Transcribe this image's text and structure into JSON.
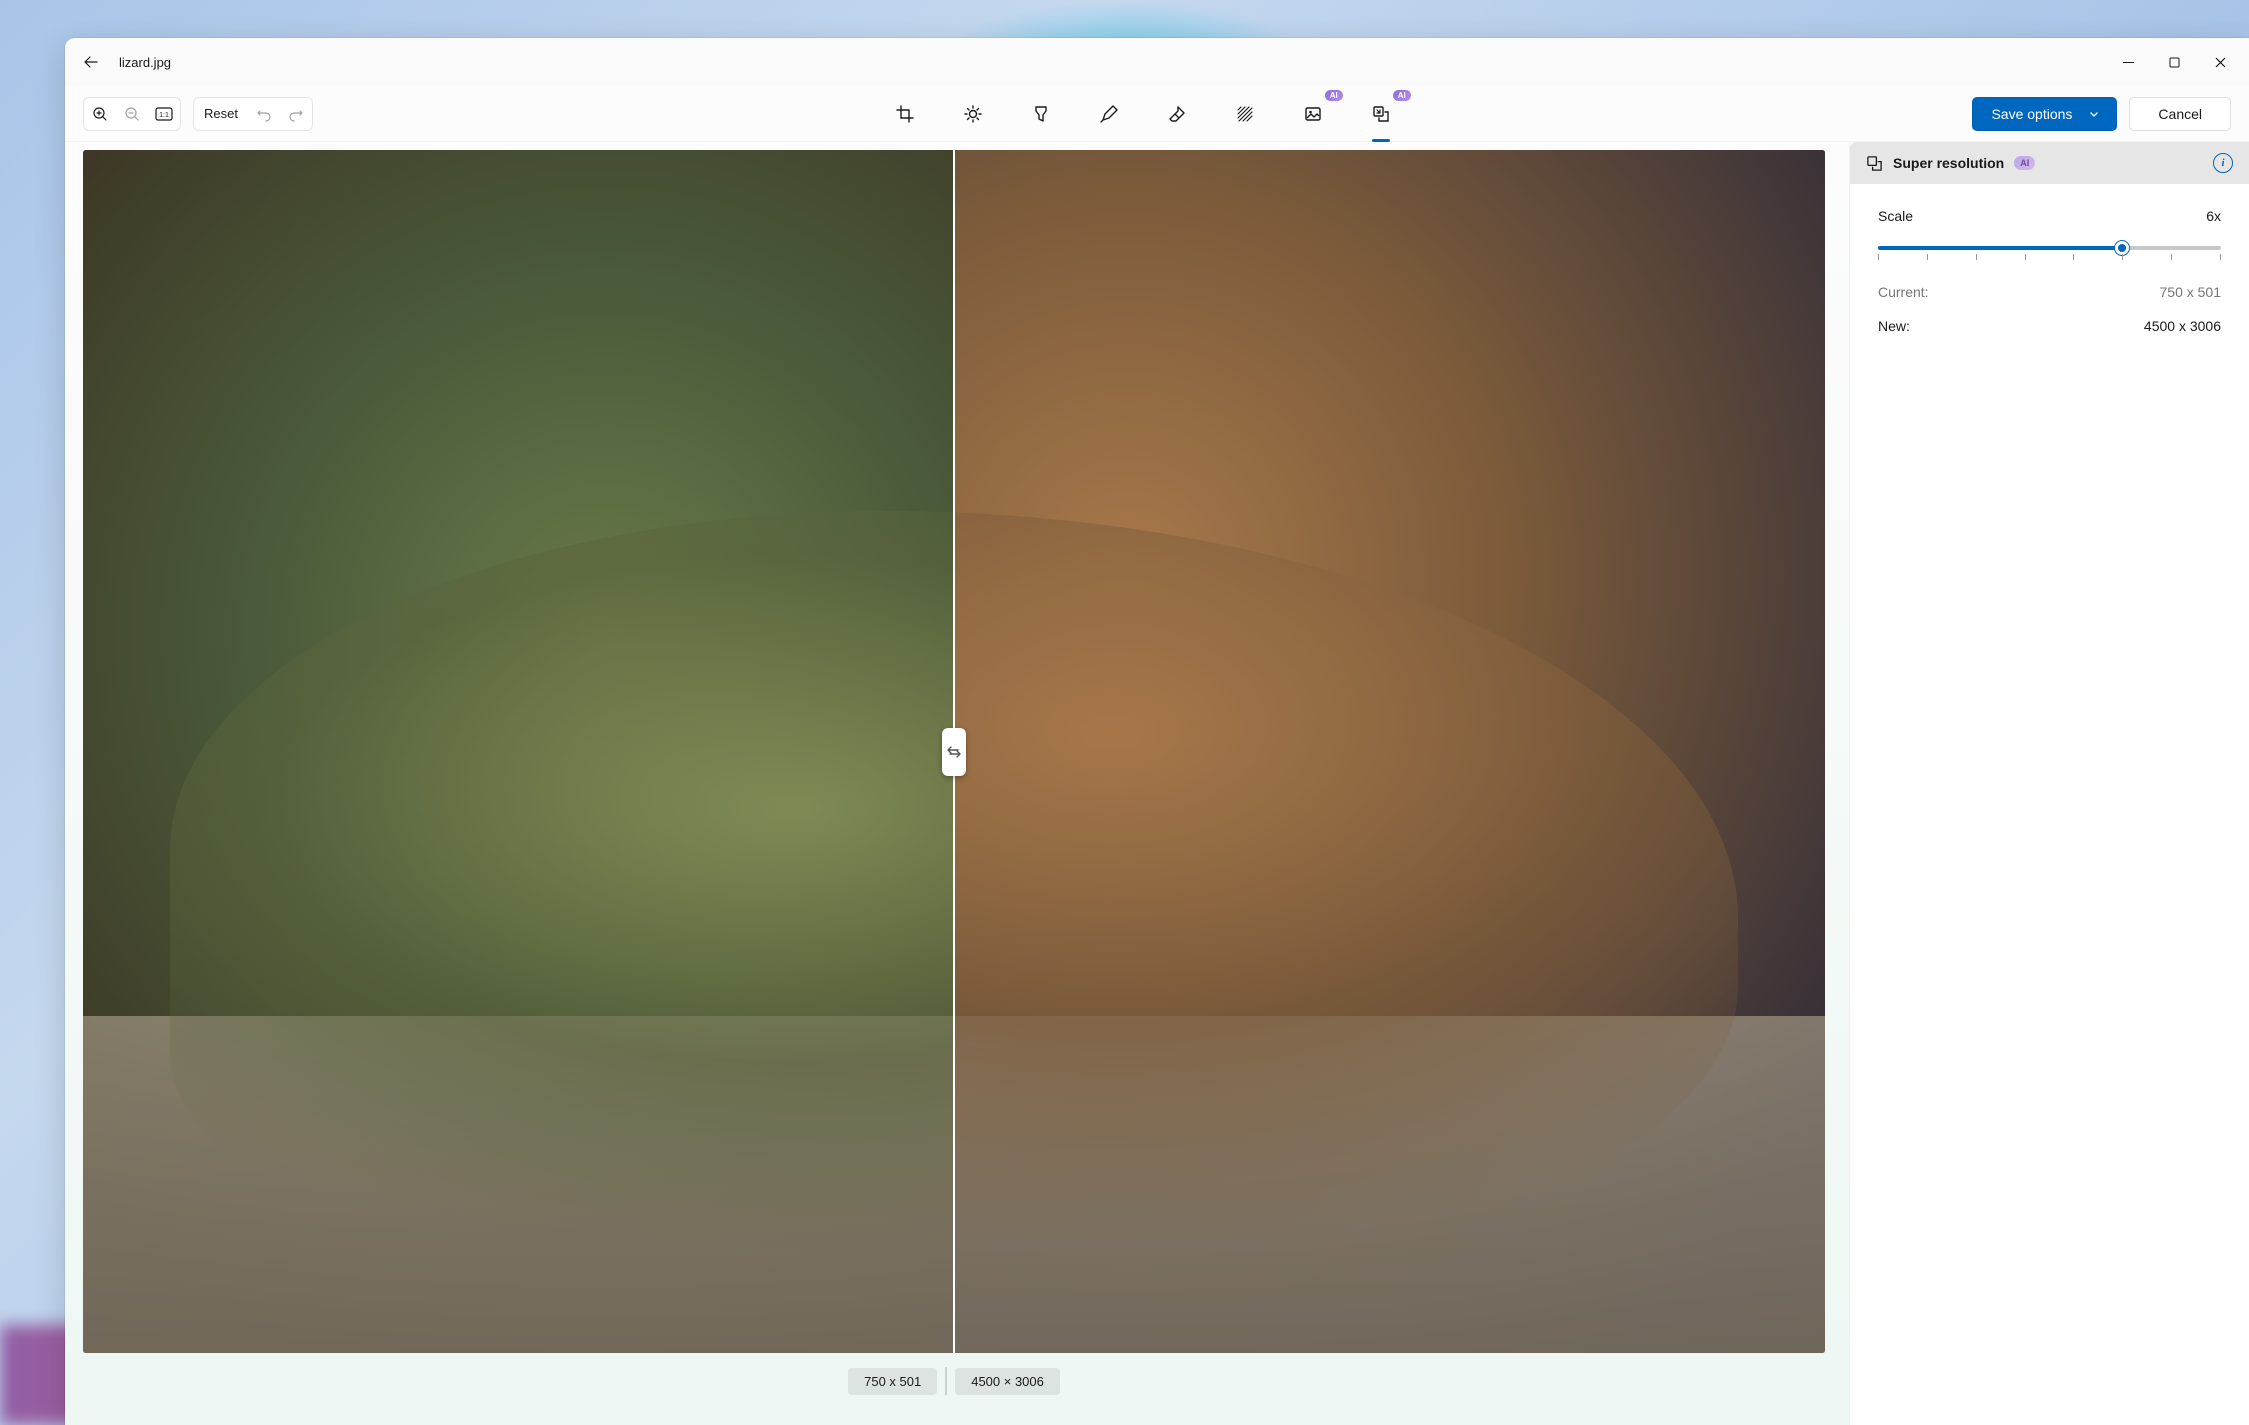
{
  "titlebar": {
    "filename": "lizard.jpg"
  },
  "toolbar": {
    "reset_label": "Reset",
    "save_label": "Save options",
    "cancel_label": "Cancel",
    "ai_badge": "AI"
  },
  "canvas": {
    "left_dim": "750 x 501",
    "right_dim": "4500 × 3006"
  },
  "panel": {
    "title": "Super resolution",
    "ai_badge": "AI",
    "scale_label": "Scale",
    "scale_value": "6x",
    "current_label": "Current:",
    "current_value": "750 x 501",
    "new_label": "New:",
    "new_value": "4500 x 3006"
  }
}
